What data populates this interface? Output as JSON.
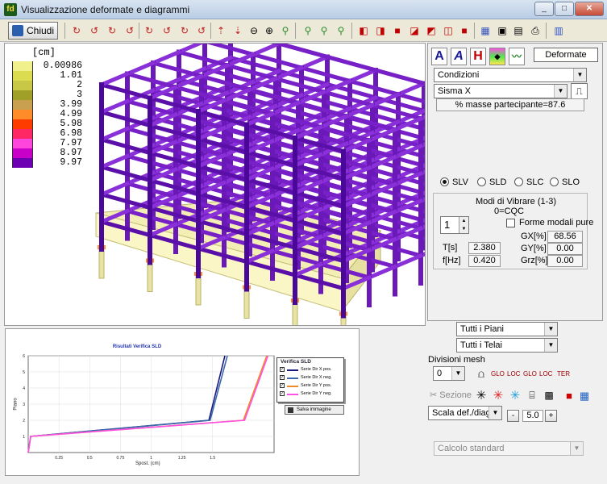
{
  "window": {
    "title": "Visualizzazione deformate e diagrammi",
    "app_icon": "fd-app-icon",
    "buttons": [
      "minimize",
      "maximize",
      "close"
    ]
  },
  "toolbar": {
    "close_label": "Chiudi",
    "icons": [
      "rotate-x-pos-icon",
      "rotate-x-neg-icon",
      "rotate-y-pos-icon",
      "rotate-y-neg-icon",
      "rotate-z-pos-icon",
      "rotate-z-neg-icon",
      "rotate-v-pos-icon",
      "rotate-v-neg-icon",
      "move-up-icon",
      "move-down-icon",
      "zoom-out-icon",
      "zoom-in-icon",
      "zoom-window-icon",
      "zoom-all-icon",
      "zoom-prev-icon",
      "zoom-fit-icon",
      "view-front-icon",
      "view-back-icon",
      "view-left-icon",
      "view-right-icon",
      "view-top-icon",
      "view-iso-icon",
      "colors-icon",
      "save-icon",
      "export-icon",
      "print-icon",
      "settings-icon"
    ]
  },
  "viewport": {
    "unit_label": "[cm]",
    "legend": [
      {
        "value": "0.00986",
        "color": "#f0f08c"
      },
      {
        "value": "1.01",
        "color": "#dcdc50"
      },
      {
        "value": "2",
        "color": "#c8c846"
      },
      {
        "value": "3",
        "color": "#a0a028"
      },
      {
        "value": "3.99",
        "color": "#c8a050"
      },
      {
        "value": "4.99",
        "color": "#ff8c28"
      },
      {
        "value": "5.98",
        "color": "#ff3c00"
      },
      {
        "value": "6.98",
        "color": "#ff2864"
      },
      {
        "value": "7.97",
        "color": "#ff46dc"
      },
      {
        "value": "8.97",
        "color": "#c800c8"
      },
      {
        "value": "9.97",
        "color": "#6e00b4"
      }
    ]
  },
  "graph": {
    "title": "Risultati Verifica SLD",
    "xlabel": "Spost. (cm)",
    "ylabel": "Piano",
    "legend_title": "Verifica SLD",
    "save_label": "Salva immagine",
    "series_labels": [
      "Serie Dir X pos.",
      "Serie Dir X neg.",
      "Serie Dir Y pos.",
      "Serie Dir Y neg."
    ]
  },
  "chart_data": {
    "type": "line",
    "title": "Risultati Verifica SLD",
    "xlabel": "Spost. (cm)",
    "ylabel": "Piano",
    "xlim": [
      0,
      2.0
    ],
    "ylim": [
      0,
      6
    ],
    "x_ticks": [
      "0.25",
      "0.5",
      "0.75",
      "1",
      "1.25",
      "1.5"
    ],
    "y_ticks": [
      "1",
      "2",
      "3",
      "4",
      "5",
      "6"
    ],
    "grid": true,
    "legend_position": "right",
    "series": [
      {
        "name": "Serie Dir X pos.",
        "color": "#1a1a80",
        "points": [
          [
            0.0,
            0
          ],
          [
            0.02,
            1
          ],
          [
            1.47,
            2
          ],
          [
            1.6,
            6
          ]
        ]
      },
      {
        "name": "Serie Dir X neg.",
        "color": "#3a6aaa",
        "points": [
          [
            0.0,
            0
          ],
          [
            0.02,
            1
          ],
          [
            1.48,
            2
          ],
          [
            1.62,
            6
          ]
        ]
      },
      {
        "name": "Serie Dir Y pos.",
        "color": "#f08c28",
        "points": [
          [
            0.0,
            0
          ],
          [
            0.02,
            1
          ],
          [
            1.75,
            2
          ],
          [
            1.94,
            6
          ]
        ]
      },
      {
        "name": "Serie Dir Y neg.",
        "color": "#ff50e6",
        "points": [
          [
            0.0,
            0
          ],
          [
            0.02,
            1
          ],
          [
            1.76,
            2
          ],
          [
            1.95,
            6
          ]
        ]
      }
    ]
  },
  "panel": {
    "deformate_label": "Deformate",
    "condizioni": "Condizioni",
    "sisma": "Sisma X",
    "masse": "% masse partecipante=87.6",
    "states": [
      {
        "label": "SLV",
        "selected": true
      },
      {
        "label": "SLD",
        "selected": false
      },
      {
        "label": "SLC",
        "selected": false
      },
      {
        "label": "SLO",
        "selected": false
      }
    ],
    "modi_title": "Modi di Vibrare (1-3)",
    "modi_sub": "0=CQC",
    "mode_value": "1",
    "forme_label": "Forme modali pure",
    "T_label": "T[s]",
    "T_value": "2.380",
    "f_label": "f[Hz]",
    "f_value": "0.420",
    "GX_label": "GX[%]",
    "GX_value": "68.56",
    "GY_label": "GY[%]",
    "GY_value": "0.00",
    "Grz_label": "Grz[%]",
    "Grz_value": "0.00"
  },
  "lower": {
    "piani": "Tutti i Piani",
    "telai": "Tutti i Telai",
    "divisioni_label": "Divisioni mesh",
    "divisioni_value": "0",
    "mesh_icons": [
      "mesh-bridge-icon",
      "mesh-glo-icon",
      "mesh-loc-icon",
      "mesh-glo-arrow-icon",
      "mesh-loc-arrow-icon",
      "mesh-ter-icon"
    ],
    "mesh_labels": [
      "GLO",
      "LOC",
      "GLO",
      "LOC",
      "TER"
    ],
    "sezione_label": "Sezione",
    "scala_label": "Scala def./diag.",
    "scala_minus": "-",
    "scala_value": "5.0",
    "scala_plus": "+",
    "calcolo": "Calcolo standard"
  }
}
